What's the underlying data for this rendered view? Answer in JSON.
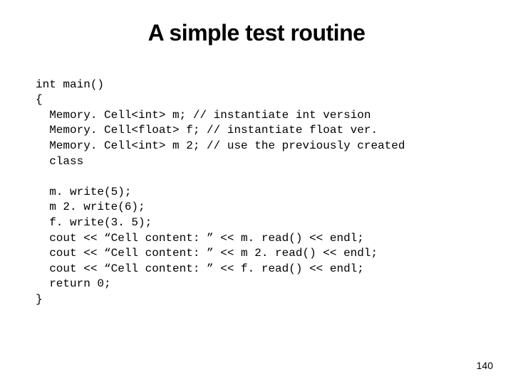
{
  "slide": {
    "title": "A simple test routine",
    "code_lines": {
      "l0": "int main()",
      "l1": "{",
      "l2": "  Memory. Cell<int> m; // instantiate int version",
      "l3": "  Memory. Cell<float> f; // instantiate float ver.",
      "l4": "  Memory. Cell<int> m 2; // use the previously created",
      "l5": "  class",
      "l6": "",
      "l7": "  m. write(5);",
      "l8": "  m 2. write(6);",
      "l9": "  f. write(3. 5);",
      "l10": "  cout << “Cell content: ” << m. read() << endl;",
      "l11": "  cout << “Cell content: ” << m 2. read() << endl;",
      "l12": "  cout << “Cell content: ” << f. read() << endl;",
      "l13": "  return 0;",
      "l14": "}"
    },
    "page_number": "140"
  }
}
